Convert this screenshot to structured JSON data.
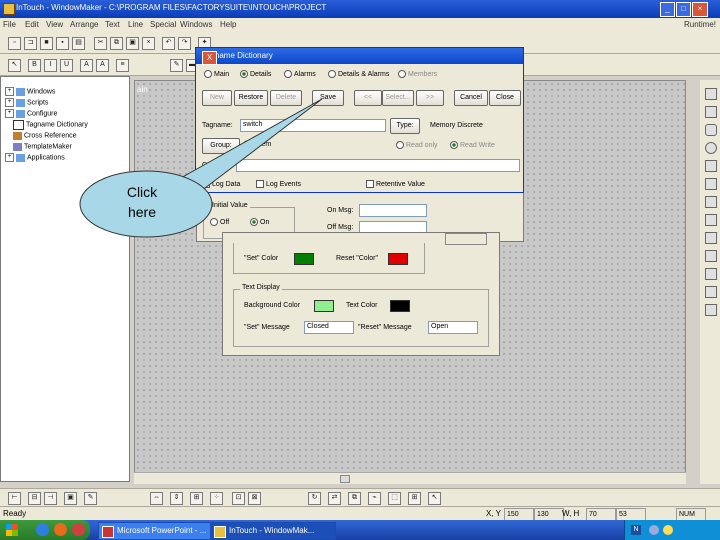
{
  "window": {
    "title": "InTouch - WindowMaker - C:\\PROGRAM FILES\\FACTORYSUITE\\INTOUCH\\PROJECT"
  },
  "menu": [
    "File",
    "Edit",
    "View",
    "Arrange",
    "Text",
    "Line",
    "Special",
    "Windows",
    "Help"
  ],
  "menu_right": "Runtime!",
  "tree": {
    "items": [
      {
        "label": "Windows",
        "expander": "+"
      },
      {
        "label": "Scripts",
        "expander": "+"
      },
      {
        "label": "Configure",
        "expander": "+"
      },
      {
        "label": "Tagname Dictionary",
        "expander": ""
      },
      {
        "label": "Cross Reference",
        "expander": ""
      },
      {
        "label": "TemplateMaker",
        "expander": ""
      },
      {
        "label": "Applications",
        "expander": "+"
      }
    ]
  },
  "canvas": {
    "tab_label": "ain"
  },
  "dialog": {
    "title": "Tagname Dictionary",
    "close_glyph": "X",
    "radios": [
      {
        "label": "Main",
        "selected": false,
        "disabled": false
      },
      {
        "label": "Details",
        "selected": true,
        "disabled": false
      },
      {
        "label": "Alarms",
        "selected": false,
        "disabled": false
      },
      {
        "label": "Details & Alarms",
        "selected": false,
        "disabled": false
      },
      {
        "label": "Members",
        "selected": false,
        "disabled": true
      }
    ],
    "buttons": [
      "New",
      "Restore",
      "Delete",
      "Save",
      "<<",
      "Select...",
      ">>",
      "Cancel",
      "Close"
    ],
    "tagname_label": "Tagname:",
    "tagname_value": "switch",
    "type_button": "Type:",
    "type_value": "Memory Discrete",
    "group_button": "Group:",
    "group_value": "$System",
    "read_only": "Read only",
    "read_write": "Read Write",
    "comment_label": "Comment:",
    "log_data": "Log Data",
    "log_events": "Log Events",
    "retentive_value": "Retentive Value"
  },
  "back_dialog": {
    "initial_value_label": "Initial Value",
    "off_label": "Off",
    "on_label": "On",
    "on_msg_label": "On Msg:",
    "off_msg_label": "Off Msg:"
  },
  "properties": {
    "set_color_label": "\"Set\" Color",
    "set_color": "#008000",
    "reset_color_label": "Reset \"Color\"",
    "reset_color": "#e00000",
    "text_display_group": "Text Display",
    "bg_color_label": "Background Color",
    "bg_color": "#90ee90",
    "text_color_label": "Text Color",
    "text_color": "#000000",
    "set_message_label": "\"Set\" Message",
    "set_message_value": "Closed",
    "reset_message_label": "\"Reset\" Message",
    "reset_message_value": "Open"
  },
  "callout": {
    "text_line1": "Click",
    "text_line2": "here"
  },
  "status": {
    "ready": "Ready",
    "xy_label": "X, Y",
    "x": "150",
    "y": "130",
    "wh_label": "W, H",
    "w": "70",
    "h": "53",
    "num": "NUM"
  },
  "taskbar": {
    "items": [
      "Microsoft PowerPoint - ...",
      "InTouch - WindowMak..."
    ],
    "tray_text": "N"
  }
}
